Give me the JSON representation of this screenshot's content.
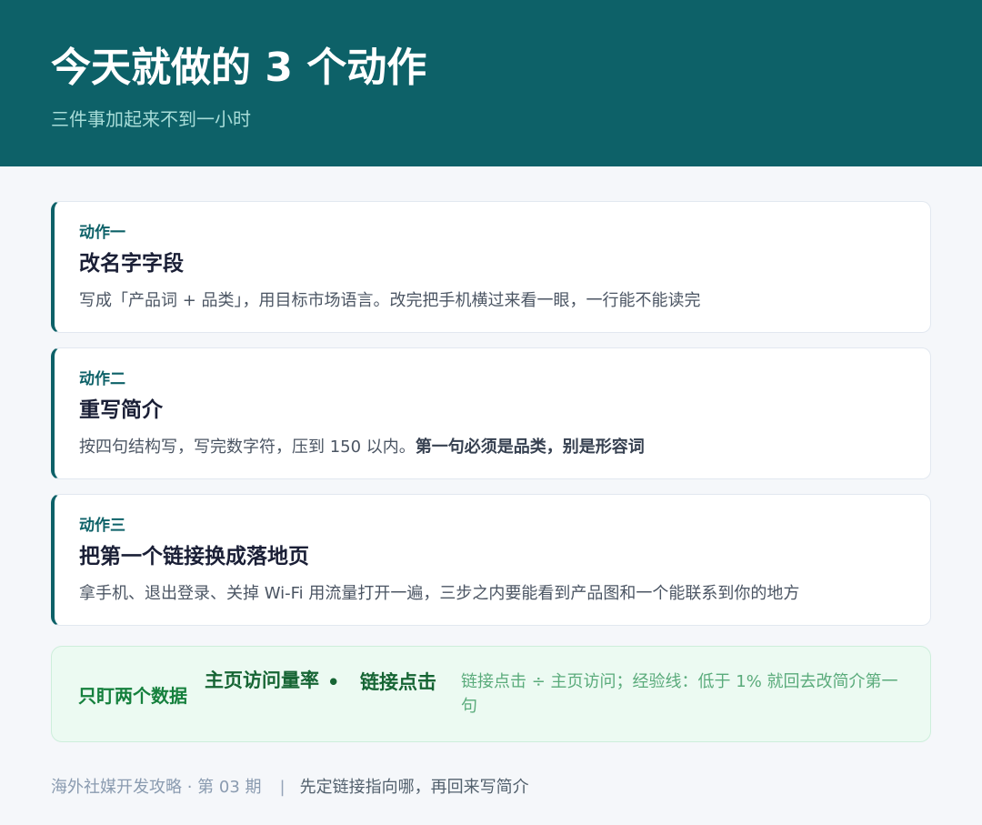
{
  "header": {
    "title": "今天就做的 3 个动作",
    "subtitle": "三件事加起来不到一小时"
  },
  "actions": [
    {
      "tag": "动作一",
      "title": "改名字字段",
      "desc": "写成「产品词 + 品类」，用目标市场语言。改完把手机横过来看一眼，一行能不能读完",
      "desc_bold": ""
    },
    {
      "tag": "动作二",
      "title": "重写简介",
      "desc": "按四句结构写，写完数字符，压到 150 以内。",
      "desc_bold": "第一句必须是品类，别是形容词"
    },
    {
      "tag": "动作三",
      "title": "把第一个链接换成落地页",
      "desc": "拿手机、退出登录、关掉 Wi-Fi 用流量打开一遍，三步之内要能看到产品图和一个能联系到你的地方",
      "desc_bold": ""
    }
  ],
  "metrics": {
    "label": "只盯两个数据",
    "metric_a": "主页访问量率",
    "separator": "•",
    "metric_b": "链接点击",
    "note": "链接点击 ÷ 主页访问；经验线：低于 1% 就回去改简介第一句"
  },
  "footer": {
    "series": "海外社媒开发攻略 · 第 03 期",
    "divider": "|",
    "motto": "先定链接指向哪，再回来写简介"
  },
  "colors": {
    "header_bg": "#0d6168",
    "accent": "#0d6168",
    "metrics_bg": "#ecfaf2",
    "metrics_text": "#166534"
  }
}
